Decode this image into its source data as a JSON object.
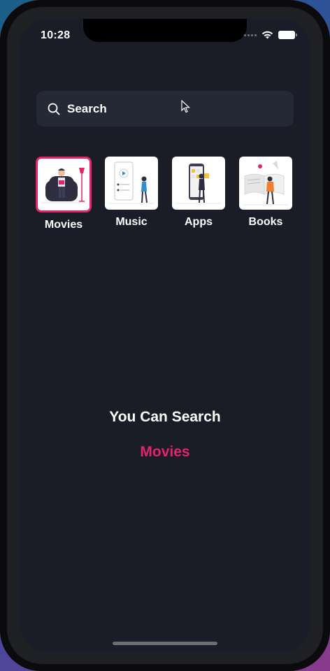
{
  "status_bar": {
    "time": "10:28"
  },
  "search": {
    "placeholder": "Search"
  },
  "categories": [
    {
      "label": "Movies",
      "icon": "movie-illustration",
      "selected": true
    },
    {
      "label": "Music",
      "icon": "music-illustration",
      "selected": false
    },
    {
      "label": "Apps",
      "icon": "apps-illustration",
      "selected": false
    },
    {
      "label": "Books",
      "icon": "books-illustration",
      "selected": false
    }
  ],
  "main": {
    "title": "You Can Search",
    "highlight": "Movies"
  },
  "colors": {
    "background": "#1a1c27",
    "search_bg": "#252936",
    "accent": "#e2246b",
    "text": "#ffffff"
  }
}
